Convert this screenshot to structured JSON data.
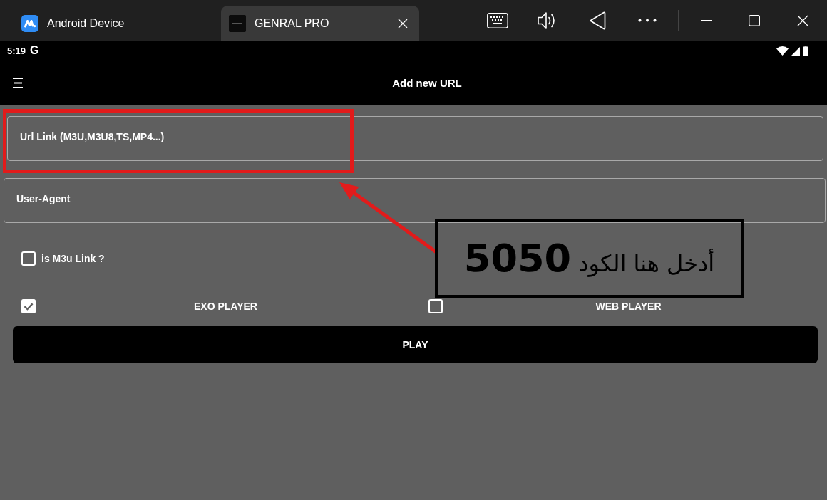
{
  "window": {
    "tabs": [
      {
        "label": "Android Device",
        "kind": "host",
        "selected": false
      },
      {
        "label": "GENRAL PRO",
        "kind": "app",
        "selected": true
      }
    ]
  },
  "status_bar": {
    "time": "5:19",
    "notification": "G"
  },
  "app_bar": {
    "title": "Add new URL"
  },
  "form": {
    "fields": [
      {
        "placeholder": "Url Link (M3U,M3U8,TS,MP4...)"
      },
      {
        "placeholder": "User-Agent"
      }
    ],
    "m3u_option": {
      "label": "is M3u Link ?",
      "checked": false
    },
    "players": [
      {
        "label": "EXO PLAYER",
        "checked": true
      },
      {
        "label": "WEB PLAYER",
        "checked": false
      }
    ],
    "play_button": "PLAY"
  },
  "annotation": {
    "text": "أدخل هنا الكود **5050**"
  }
}
